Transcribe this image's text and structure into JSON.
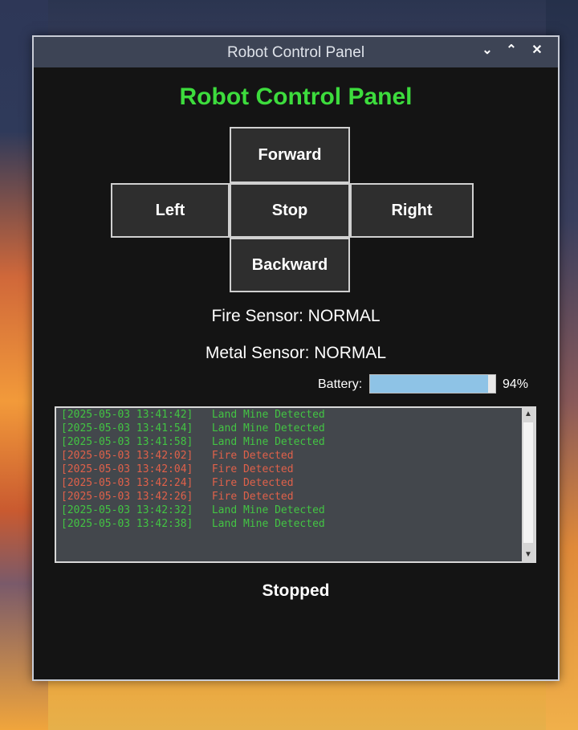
{
  "window": {
    "title": "Robot Control Panel",
    "controls": {
      "minimize": "⌄",
      "maximize": "⌃",
      "close": "✕"
    }
  },
  "app": {
    "heading": "Robot Control Panel"
  },
  "controls": {
    "forward": "Forward",
    "left": "Left",
    "stop": "Stop",
    "right": "Right",
    "backward": "Backward"
  },
  "sensors": {
    "fire": "Fire Sensor: NORMAL",
    "metal": "Metal Sensor: NORMAL"
  },
  "battery": {
    "label": "Battery:",
    "percent_text": "94%",
    "level": 0.94
  },
  "log": [
    {
      "text": "[2025-05-03 13:41:42]   Land Mine Detected",
      "kind": "green"
    },
    {
      "text": "[2025-05-03 13:41:54]   Land Mine Detected",
      "kind": "green"
    },
    {
      "text": "[2025-05-03 13:41:58]   Land Mine Detected",
      "kind": "green"
    },
    {
      "text": "[2025-05-03 13:42:02]   Fire Detected",
      "kind": "red"
    },
    {
      "text": "[2025-05-03 13:42:04]   Fire Detected",
      "kind": "red"
    },
    {
      "text": "[2025-05-03 13:42:24]   Fire Detected",
      "kind": "red"
    },
    {
      "text": "[2025-05-03 13:42:26]   Fire Detected",
      "kind": "red"
    },
    {
      "text": "[2025-05-03 13:42:32]   Land Mine Detected",
      "kind": "green"
    },
    {
      "text": "[2025-05-03 13:42:38]   Land Mine Detected",
      "kind": "green"
    }
  ],
  "status": {
    "text": "Stopped"
  },
  "colors": {
    "accent_green": "#3ddc3d",
    "log_green": "#43c443",
    "log_red": "#e0614a",
    "battery_fill": "#8ec3e6"
  }
}
